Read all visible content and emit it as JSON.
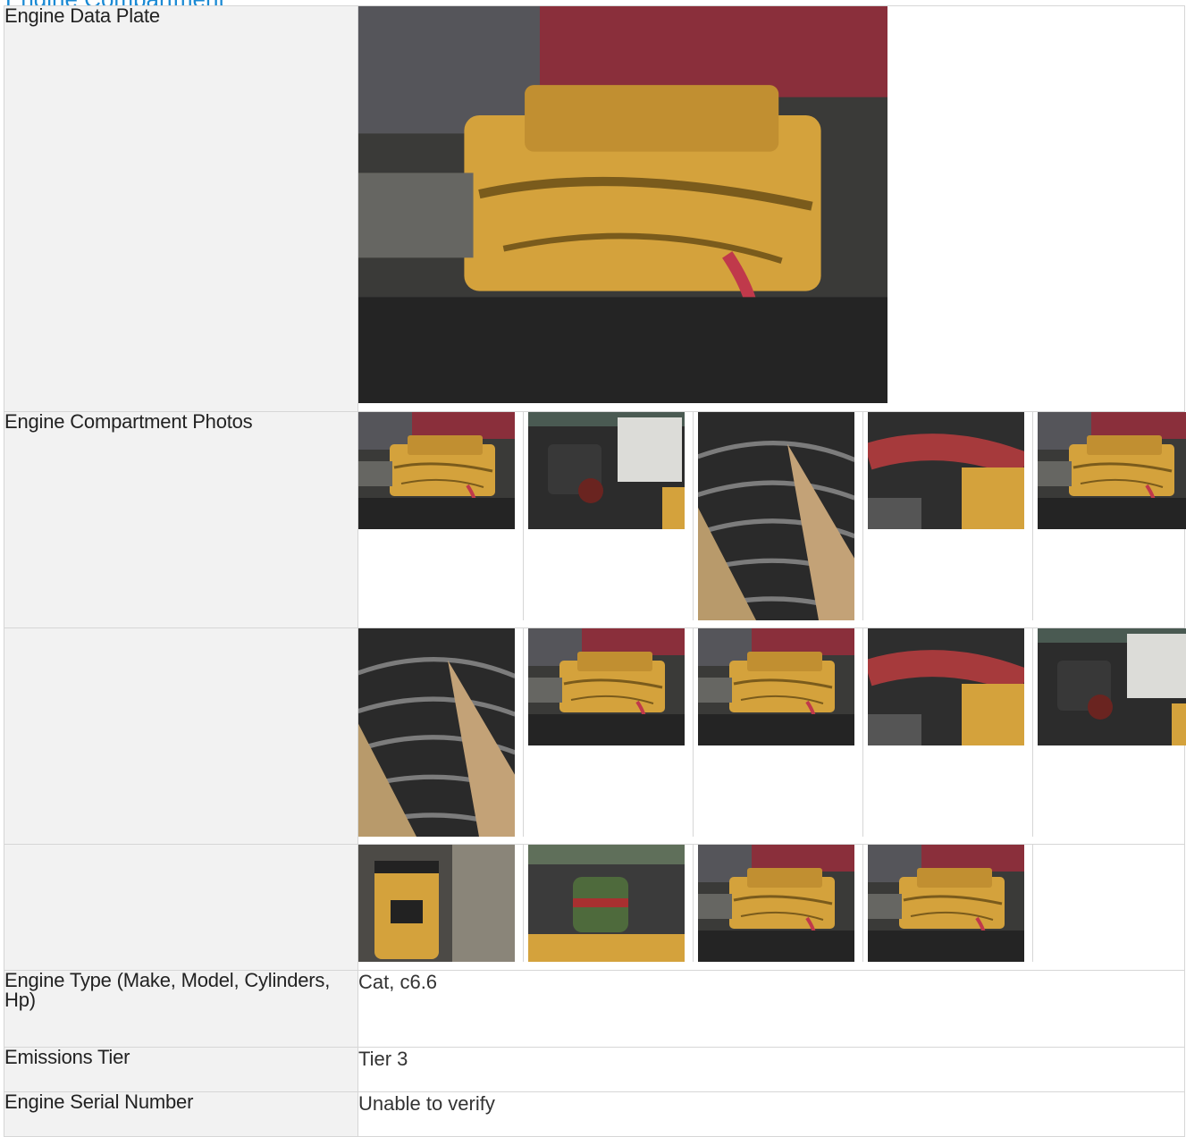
{
  "section": {
    "title": "Engine Compartment"
  },
  "rows": {
    "data_plate": {
      "label": "Engine Data Plate",
      "photo": "engine-photo"
    },
    "compartment": {
      "label": "Engine Compartment Photos",
      "photo_count": 14
    },
    "engine_type": {
      "label": "Engine Type (Make, Model, Cylinders, Hp)",
      "value": "Cat, c6.6"
    },
    "emissions": {
      "label": "Emissions Tier",
      "value": "Tier 3"
    },
    "serial": {
      "label": "Engine Serial Number",
      "value": "Unable to verify"
    }
  },
  "colors": {
    "accent": "#1a8ad4",
    "label_bg": "#f2f2f2",
    "border": "#d6d6d6",
    "engine_yellow": "#d4a23c"
  }
}
